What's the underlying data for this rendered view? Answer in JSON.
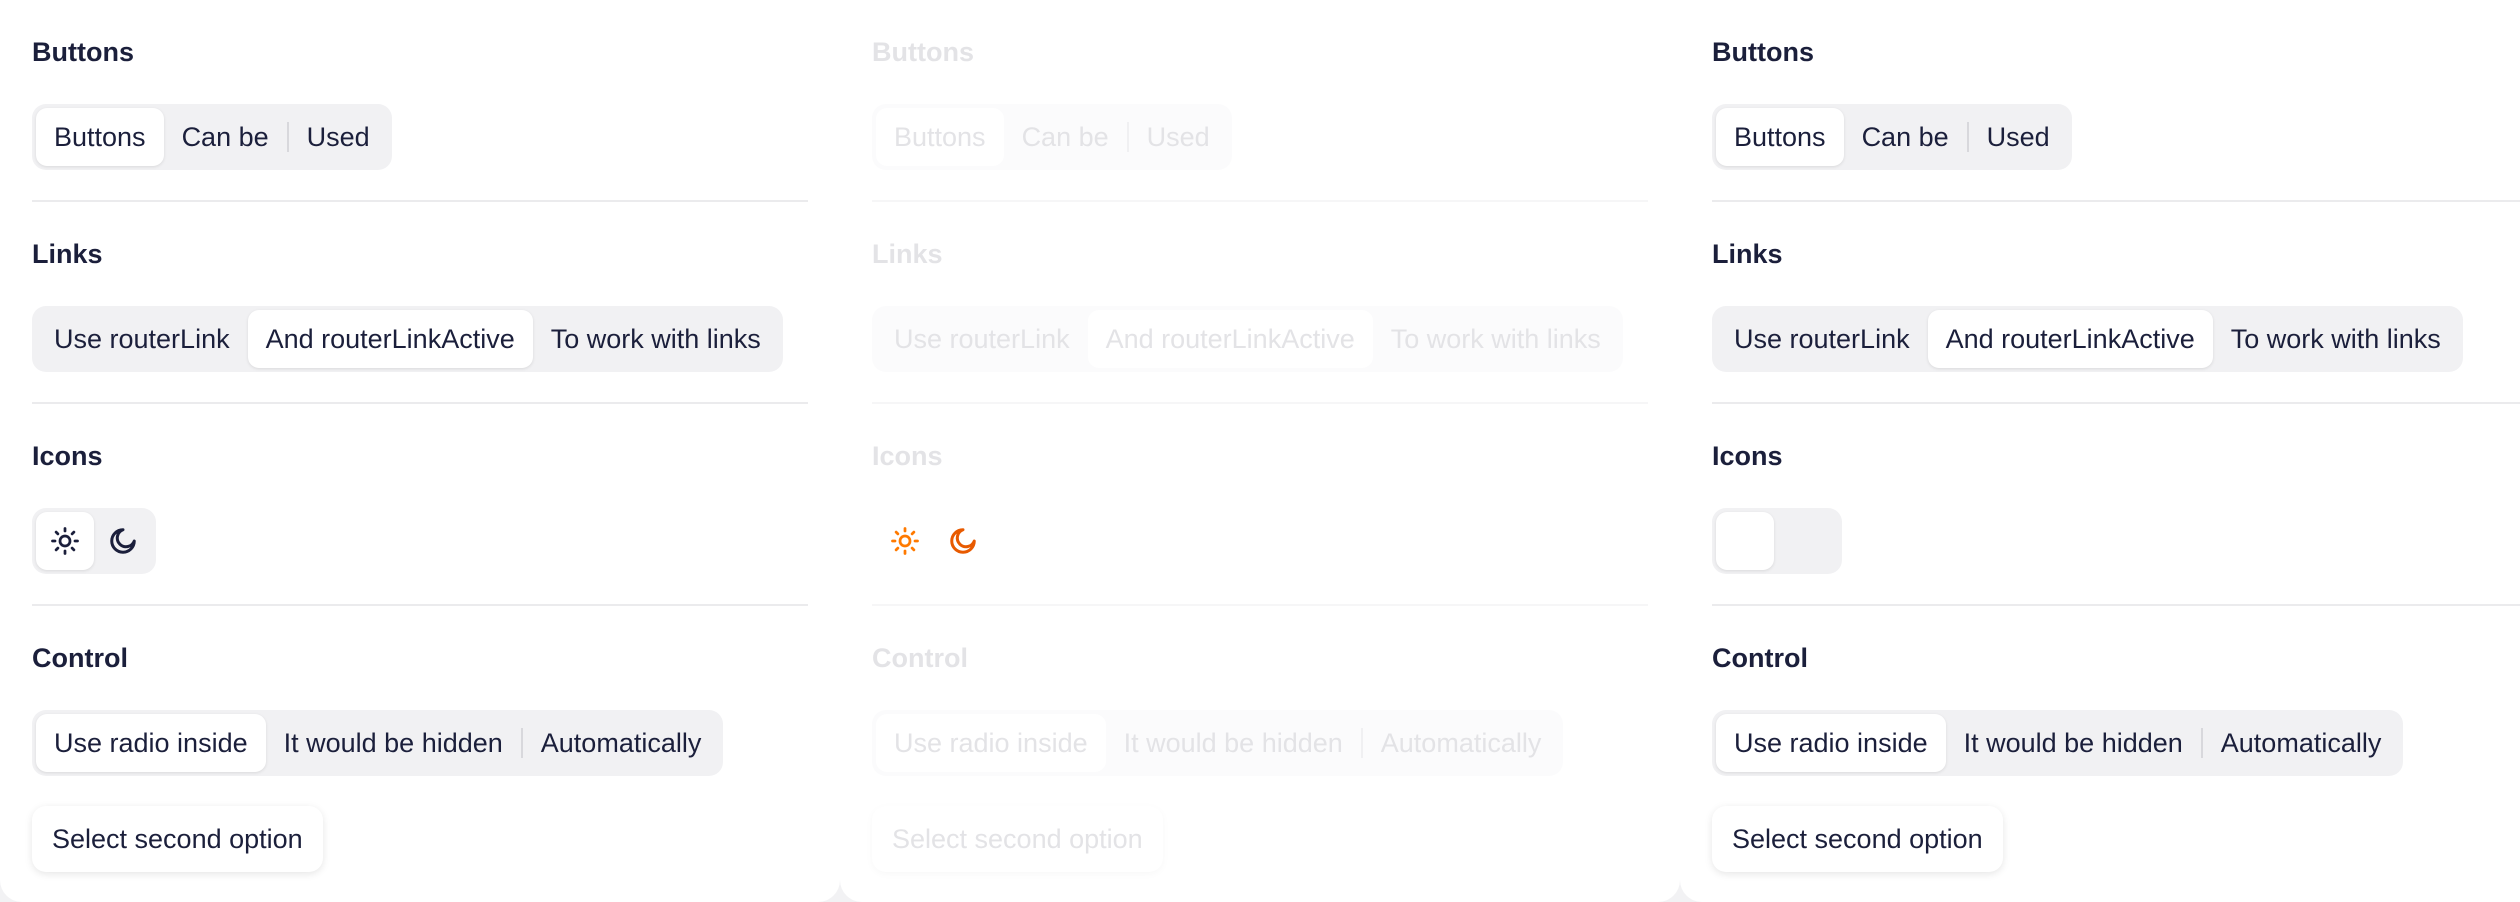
{
  "sections": {
    "buttons": {
      "title": "Buttons",
      "options": [
        "Buttons",
        "Can be",
        "Used"
      ],
      "selected": 0
    },
    "links": {
      "title": "Links",
      "options": [
        "Use routerLink",
        "And routerLinkActive",
        "To work with links"
      ],
      "selected": 1
    },
    "icons": {
      "title": "Icons",
      "options": [
        "sun-icon",
        "moon-icon"
      ],
      "selected": 0
    },
    "control": {
      "title": "Control",
      "options": [
        "Use radio inside",
        "It would be hidden",
        "Automatically"
      ],
      "selected": 0
    }
  },
  "select_second_option": "Select second option",
  "variants": [
    "default",
    "disabled",
    "toggle"
  ],
  "colors": {
    "text": "#1b1f3b",
    "disabled_text": "#e3e3e6",
    "segment_bg": "#f1f1f3",
    "active_bg": "#ffffff",
    "icon_accent": "#ff7a00",
    "icon_accent_dark": "#e85a00"
  }
}
